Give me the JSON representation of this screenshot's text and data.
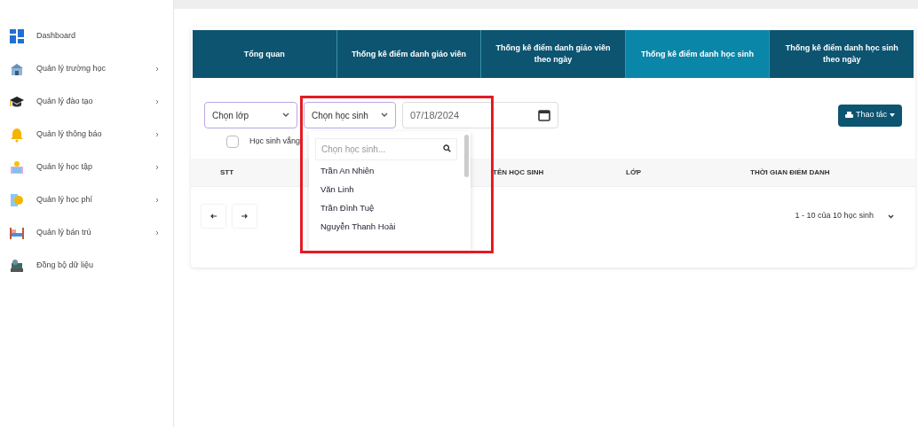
{
  "sidebar": {
    "items": [
      {
        "label": "Dashboard",
        "has_children": false
      },
      {
        "label": "Quản lý trường học",
        "has_children": true
      },
      {
        "label": "Quản lý đào tạo",
        "has_children": true
      },
      {
        "label": "Quản lý thông báo",
        "has_children": true
      },
      {
        "label": "Quản lý học tập",
        "has_children": true
      },
      {
        "label": "Quản lý học phí",
        "has_children": true
      },
      {
        "label": "Quản lý bán trú",
        "has_children": true
      },
      {
        "label": "Đồng bộ dữ liệu",
        "has_children": false
      }
    ]
  },
  "tabs": [
    {
      "label": "Tổng quan",
      "selected": false
    },
    {
      "label": "Thống kê điểm danh giáo viên",
      "selected": false
    },
    {
      "label": "Thống kê điểm danh giáo viên theo ngày",
      "selected": false
    },
    {
      "label": "Thống kê điểm danh học sinh",
      "selected": true
    },
    {
      "label": "Thống kê điểm danh học sinh theo ngày",
      "selected": false
    }
  ],
  "filters": {
    "class_select": "Chọn lớp",
    "student_select": "Chọn học sinh",
    "date": "07/18/2024",
    "absent_checkbox": {
      "label": "Học sinh vắng",
      "checked": false
    }
  },
  "actions_button": "Thao tác",
  "dropdown": {
    "search_placeholder": "Chọn học sinh...",
    "options": [
      "Trần An Nhiên",
      "Văn Linh",
      "Trần Đình Tuệ",
      "Nguyễn Thanh Hoài"
    ]
  },
  "table": {
    "columns": [
      "STT",
      "TÊN HỌC SINH",
      "LỚP",
      "THỜI GIAN ĐIỂM DANH"
    ]
  },
  "pagination": {
    "summary": "1 - 10 của 10 học sinh"
  }
}
